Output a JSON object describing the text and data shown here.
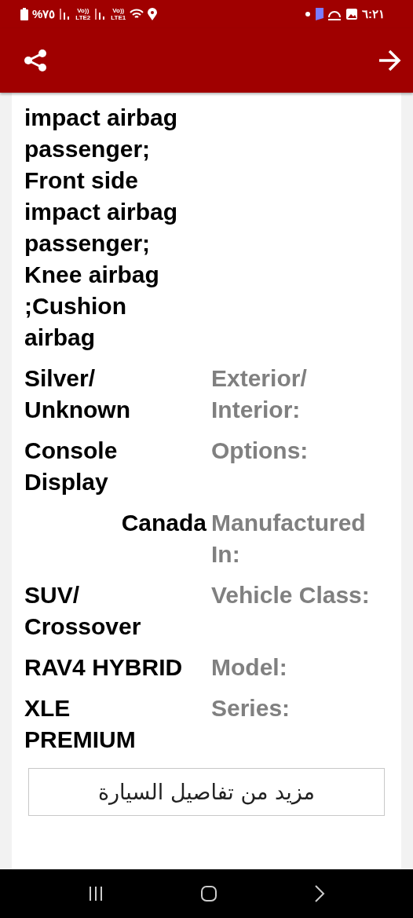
{
  "status_bar": {
    "battery": "%٧٥",
    "sim_2": {
      "top": "Vo))",
      "bottom": "LTE2"
    },
    "sim_1": {
      "top": "Vo))",
      "bottom": "LTE1"
    },
    "time": "٦:٢١"
  },
  "app_bar": {
    "actions": [
      {
        "kind": "share"
      },
      {
        "kind": "back"
      }
    ]
  },
  "specs": [
    {
      "value": "impact airbag passenger; Front side impact airbag passenger; Knee airbag ;Cushion airbag",
      "kind": "left"
    },
    {
      "value": "Silver/ Unknown",
      "label": "Exterior/ Interior:",
      "kind": "left"
    },
    {
      "value": "Console Display",
      "label": "Options:",
      "kind": "left"
    },
    {
      "value": "Canada",
      "label": "Manufactured In:",
      "kind": "right"
    },
    {
      "value": "SUV/ Crossover",
      "label": "Vehicle Class:",
      "kind": "left"
    },
    {
      "value": "RAV4 HYBRID",
      "label": "Model:",
      "kind": "left"
    },
    {
      "value": "XLE PREMIUM",
      "label": "Series:",
      "kind": "left"
    }
  ],
  "more_button": {
    "label": "مزيد من تفاصيل السيارة"
  }
}
